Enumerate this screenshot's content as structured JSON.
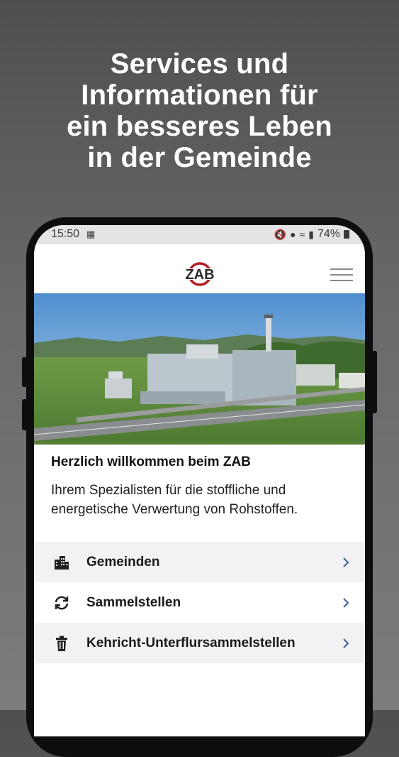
{
  "headline": {
    "lines": [
      "Services und",
      "Informationen für",
      "ein besseres Leben",
      "in der Gemeinde"
    ]
  },
  "status_bar": {
    "time": "15:50",
    "battery": "74%"
  },
  "app": {
    "logo_text": "ZAB"
  },
  "welcome": {
    "title": "Herzlich willkommen beim ZAB",
    "text": "Ihrem Spezialisten für die stoffliche und energetische Verwertung von Rohstoffen."
  },
  "menu": {
    "items": [
      {
        "label": "Gemeinden",
        "icon": "buildings-icon"
      },
      {
        "label": "Sammelstellen",
        "icon": "recycle-arrows-icon"
      },
      {
        "label": "Kehricht-Unterflursammelstellen",
        "icon": "trash-icon"
      }
    ]
  },
  "colors": {
    "brand_red": "#b31e24",
    "background": "#5e5e60",
    "row_shade": "#f2f2f4"
  }
}
